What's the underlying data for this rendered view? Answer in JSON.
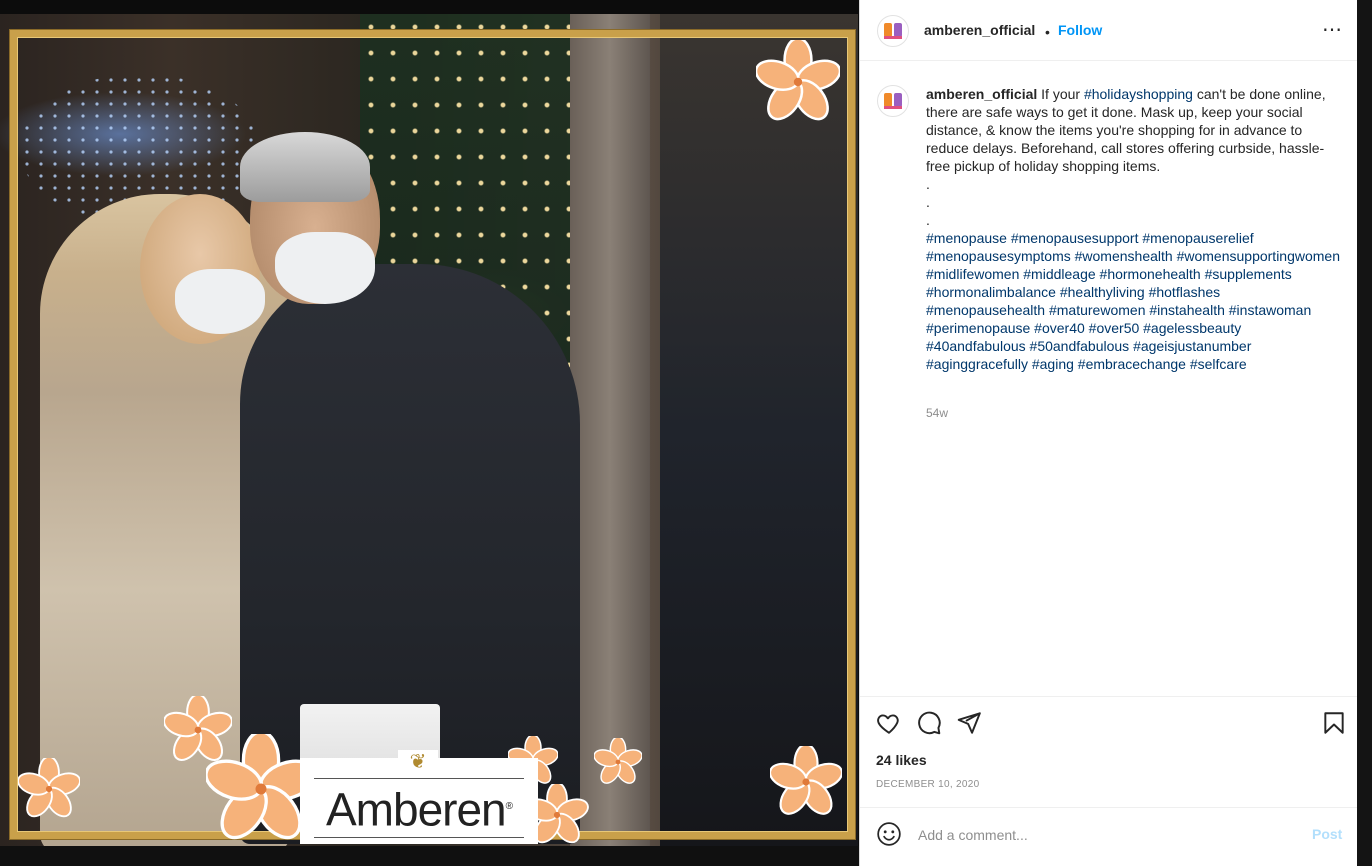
{
  "post": {
    "logo_text": "Amberen",
    "logo_mark": "®"
  },
  "header": {
    "username": "amberen_official",
    "separator": "•",
    "follow_label": "Follow",
    "more_label": "⋯"
  },
  "caption": {
    "username": "amberen_official",
    "text_before": "If your ",
    "hashtag_inline": "#holidayshopping",
    "text_after": " can't be done online, there are safe ways to get it done. Mask up, keep your social distance, & know the items you're shopping for in advance to reduce delays. Beforehand, call stores offering curbside, hassle-free pickup of holiday shopping items.",
    "dots": [
      ".",
      ".",
      "."
    ],
    "hashtags": "#menopause #menopausesupport #menopauserelief #menopausesymptoms #womenshealth #womensupportingwomen #midlifewomen #middleage #hormonehealth #supplements #hormonalimbalance #healthyliving #hotflashes #menopausehealth #maturewomen #instahealth #instawoman #perimenopause #over40 #over50 #agelessbeauty #40andfabulous #50andfabulous #ageisjustanumber #aginggracefully #aging #embracechange #selfcare",
    "time_ago": "54w"
  },
  "actions": {
    "icons": [
      "heart-icon",
      "comment-icon",
      "share-icon",
      "bookmark-icon"
    ]
  },
  "stats": {
    "likes": "24 likes",
    "date": "DECEMBER 10, 2020"
  },
  "comment": {
    "placeholder": "Add a comment...",
    "post_label": "Post"
  },
  "colors": {
    "accent": "#0095f6",
    "hashtag": "#00376b",
    "post_disabled": "#b2dffc",
    "frame_gold": "#c9a04a",
    "flower": "#f6b27a"
  }
}
